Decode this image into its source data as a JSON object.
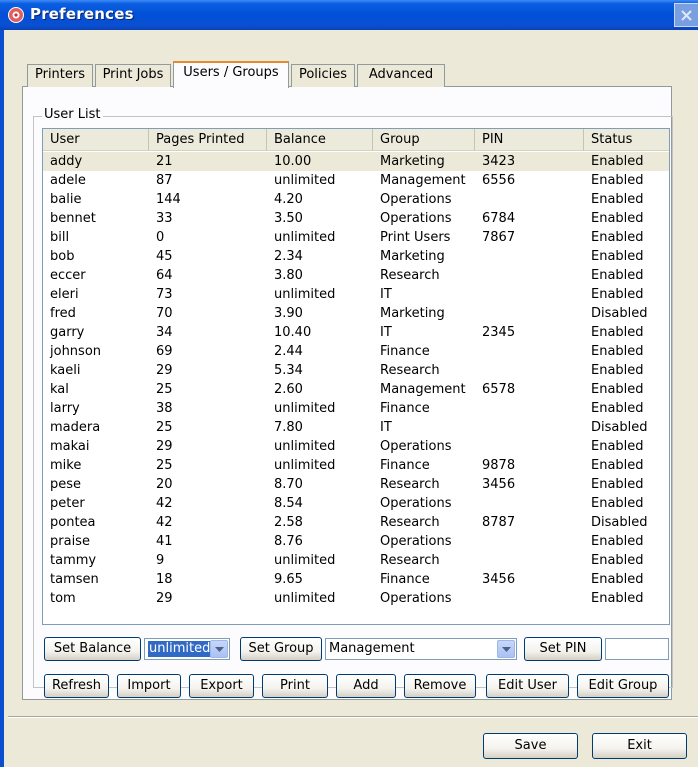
{
  "window": {
    "title": "Preferences"
  },
  "tabs": [
    "Printers",
    "Print Jobs",
    "Users / Groups",
    "Policies",
    "Advanced"
  ],
  "active_tab": "Users / Groups",
  "group_label": "User List",
  "columns": [
    "User",
    "Pages Printed",
    "Balance",
    "Group",
    "PIN",
    "Status"
  ],
  "rows": [
    [
      "addy",
      "21",
      "10.00",
      "Marketing",
      "3423",
      "Enabled"
    ],
    [
      "adele",
      "87",
      "unlimited",
      "Management",
      "6556",
      "Enabled"
    ],
    [
      "balie",
      "144",
      "4.20",
      "Operations",
      "",
      "Enabled"
    ],
    [
      "bennet",
      "33",
      "3.50",
      "Operations",
      "6784",
      "Enabled"
    ],
    [
      "bill",
      "0",
      "unlimited",
      "Print Users",
      "7867",
      "Enabled"
    ],
    [
      "bob",
      "45",
      "2.34",
      "Marketing",
      "",
      "Enabled"
    ],
    [
      "eccer",
      "64",
      "3.80",
      "Research",
      "",
      "Enabled"
    ],
    [
      "eleri",
      "73",
      "unlimited",
      "IT",
      "",
      "Enabled"
    ],
    [
      "fred",
      "70",
      "3.90",
      "Marketing",
      "",
      "Disabled"
    ],
    [
      "garry",
      "34",
      "10.40",
      "IT",
      "2345",
      "Enabled"
    ],
    [
      "johnson",
      "69",
      "2.44",
      "Finance",
      "",
      "Enabled"
    ],
    [
      "kaeli",
      "29",
      "5.34",
      "Research",
      "",
      "Enabled"
    ],
    [
      "kal",
      "25",
      "2.60",
      "Management",
      "6578",
      "Enabled"
    ],
    [
      "larry",
      "38",
      "unlimited",
      "Finance",
      "",
      "Enabled"
    ],
    [
      "madera",
      "25",
      "7.80",
      "IT",
      "",
      "Disabled"
    ],
    [
      "makai",
      "29",
      "unlimited",
      "Operations",
      "",
      "Enabled"
    ],
    [
      "mike",
      "25",
      "unlimited",
      "Finance",
      "9878",
      "Enabled"
    ],
    [
      "pese",
      "20",
      "8.70",
      "Research",
      "3456",
      "Enabled"
    ],
    [
      "peter",
      "42",
      "8.54",
      "Operations",
      "",
      "Enabled"
    ],
    [
      "pontea",
      "42",
      "2.58",
      "Research",
      "8787",
      "Disabled"
    ],
    [
      "praise",
      "41",
      "8.76",
      "Operations",
      "",
      "Enabled"
    ],
    [
      "tammy",
      "9",
      "unlimited",
      "Research",
      "",
      "Enabled"
    ],
    [
      "tamsen",
      "18",
      "9.65",
      "Finance",
      "3456",
      "Enabled"
    ],
    [
      "tom",
      "29",
      "unlimited",
      "Operations",
      "",
      "Enabled"
    ]
  ],
  "selected_row": "addy",
  "controls": {
    "set_balance": "Set Balance",
    "balance_value": "unlimited",
    "set_group": "Set Group",
    "group_value": "Management",
    "set_pin": "Set PIN",
    "pin_value": ""
  },
  "actions": [
    "Refresh",
    "Import",
    "Export",
    "Print",
    "Add",
    "Remove",
    "Edit User",
    "Edit Group"
  ],
  "footer": {
    "save": "Save",
    "exit": "Exit"
  },
  "colors": {
    "titlebar": "#0150d8",
    "selection": "#316ac5",
    "tab_highlight": "#e68b2c"
  }
}
